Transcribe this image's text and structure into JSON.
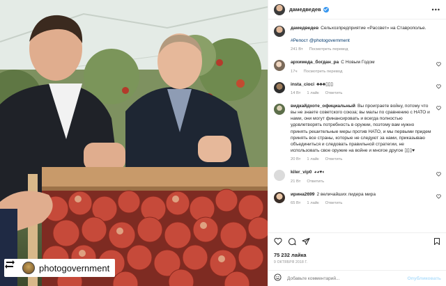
{
  "post": {
    "author": "дамедведев",
    "repost_badge_name": "photogovernment"
  },
  "caption": {
    "user": "дамедведев",
    "text": "Сельхозпредприятие «Рассвет» на Ставрополье.",
    "tags": "#Репост @photogovernment",
    "time": "241 Вт",
    "translate": "Посмотреть перевод"
  },
  "comments": [
    {
      "user": "архимеда_богдан_ра",
      "text": "С Новым Годом",
      "time": "17ч",
      "likes": "",
      "reply": "",
      "translate": "Посмотреть перевод"
    },
    {
      "user": "insta_cioci",
      "text": "♣♣♣▯▯▯",
      "time": "14 Вт",
      "likes": "1 лайк",
      "reply": "Ответить",
      "translate": ""
    },
    {
      "user": "видкайдхоте_официальный",
      "text": "Вы проиграете войну, потому что вы не знаете советского союза; вы малы по сравнению с НАТО и нами, они могут финансировать и всегда полностью удовлетворять потребность в оружии, поэтому вам нужно принять решительные меры против НАТО, и мы первыми придем принять все страны, которые не следуют за нами, приказываю объединиться и следовать правильной стратегии, не использовать свое оружие на войне и многое другое ▯▯▯♥",
      "time": "20 Вт",
      "likes": "1 лайк",
      "reply": "Ответить",
      "translate": ""
    },
    {
      "user": "kiler_vip0",
      "text": "◕◕♥◐",
      "time": "21 Вт",
      "likes": "",
      "reply": "Ответить",
      "translate": ""
    },
    {
      "user": "ирина2699",
      "text": "2 величайших лидера мира",
      "time": "65 Вт",
      "likes": "1 лайк",
      "reply": "Ответить",
      "translate": ""
    }
  ],
  "stats": {
    "likes": "75 232 лайка",
    "date": "9 ОКТЯБРЯ 2018 Г."
  },
  "comment_box": {
    "placeholder": "Добавьте комментарий...",
    "publish": "Опубликовать"
  },
  "icons": {
    "header_more": "more-options-icon",
    "heart": "heart-icon",
    "comment": "comment-icon",
    "share": "share-icon",
    "bookmark": "bookmark-icon",
    "emoji": "emoji-icon",
    "verified": "verified-badge-icon",
    "repost": "repost-icon"
  },
  "colors": {
    "verified": "#3897f0",
    "link": "#00376b",
    "meta_gray": "#8e8e8e",
    "publish_disabled": "#b2dffc"
  }
}
